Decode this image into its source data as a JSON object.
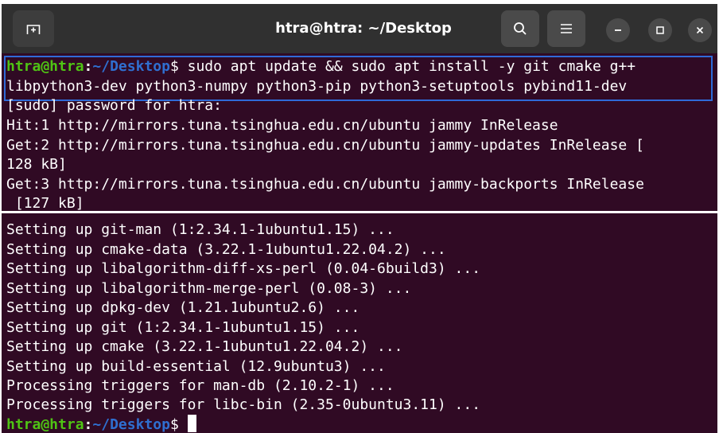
{
  "window": {
    "title": "htra@htra: ~/Desktop"
  },
  "titlebar": {
    "new_tab_icon": "new-tab-icon",
    "search_icon": "search-icon",
    "menu_icon": "hamburger-menu-icon",
    "minimize_icon": "minimize-icon",
    "maximize_icon": "maximize-icon",
    "close_icon": "close-icon"
  },
  "colors": {
    "terminal_bg": "#300a24",
    "titlebar_bg": "#303030",
    "prompt_user": "#4fc414",
    "prompt_path": "#2f6fd0",
    "highlight_border": "#2f6bd8"
  },
  "prompt": {
    "user_host": "htra@htra",
    "colon": ":",
    "path": "~/Desktop",
    "dollar": "$"
  },
  "command": {
    "line1": " sudo apt update && sudo apt install -y git cmake g++",
    "line2": "libpython3-dev python3-numpy python3-pip python3-setuptools pybind11-dev"
  },
  "output_top": [
    "[sudo] password for htra:",
    "Hit:1 http://mirrors.tuna.tsinghua.edu.cn/ubuntu jammy InRelease",
    "Get:2 http://mirrors.tuna.tsinghua.edu.cn/ubuntu jammy-updates InRelease [",
    "128 kB]",
    "Get:3 http://mirrors.tuna.tsinghua.edu.cn/ubuntu jammy-backports InRelease",
    " [127 kB]"
  ],
  "output_bottom": [
    "Setting up git-man (1:2.34.1-1ubuntu1.15) ...",
    "Setting up cmake-data (3.22.1-1ubuntu1.22.04.2) ...",
    "Setting up libalgorithm-diff-xs-perl (0.04-6build3) ...",
    "Setting up libalgorithm-merge-perl (0.08-3) ...",
    "Setting up dpkg-dev (1.21.1ubuntu2.6) ...",
    "Setting up git (1:2.34.1-1ubuntu1.15) ...",
    "Setting up cmake (3.22.1-1ubuntu1.22.04.2) ...",
    "Setting up build-essential (12.9ubuntu3) ...",
    "Processing triggers for man-db (2.10.2-1) ...",
    "Processing triggers for libc-bin (2.35-0ubuntu3.11) ..."
  ]
}
